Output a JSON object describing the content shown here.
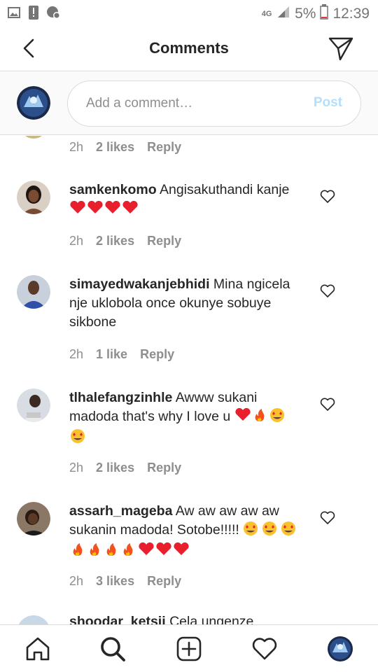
{
  "status_bar": {
    "network": "4G",
    "battery": "5%",
    "time": "12:39"
  },
  "header": {
    "title": "Comments"
  },
  "compose": {
    "placeholder": "Add a comment…",
    "post_label": "Post"
  },
  "partial_top": {
    "time": "2h",
    "likes": "2 likes",
    "reply": "Reply"
  },
  "comments": [
    {
      "username": "samkenkomo",
      "text": "Angisakuthandi kanje",
      "time": "2h",
      "likes": "2 likes",
      "reply": "Reply"
    },
    {
      "username": "simayedwakanjebhidi",
      "text": "Mina ngicela nje uklobola once okunye sobuye sikbone",
      "time": "2h",
      "likes": "1 like",
      "reply": "Reply"
    },
    {
      "username": "tlhalefangzinhle",
      "text": "Awww sukani madoda that's why I love u",
      "time": "2h",
      "likes": "2 likes",
      "reply": "Reply"
    },
    {
      "username": "assarh_mageba",
      "text": "Aw aw aw aw aw sukanin madoda! Sotobe!!!!!",
      "time": "2h",
      "likes": "3 likes",
      "reply": "Reply"
    },
    {
      "username": "shoodar_ketsii",
      "text": "Cela ungenze"
    }
  ],
  "colors": {
    "post_disabled": "#b2dffc",
    "heart_emoji": "#e8202e",
    "text_primary": "#262626",
    "text_secondary": "#8e8e8e"
  }
}
